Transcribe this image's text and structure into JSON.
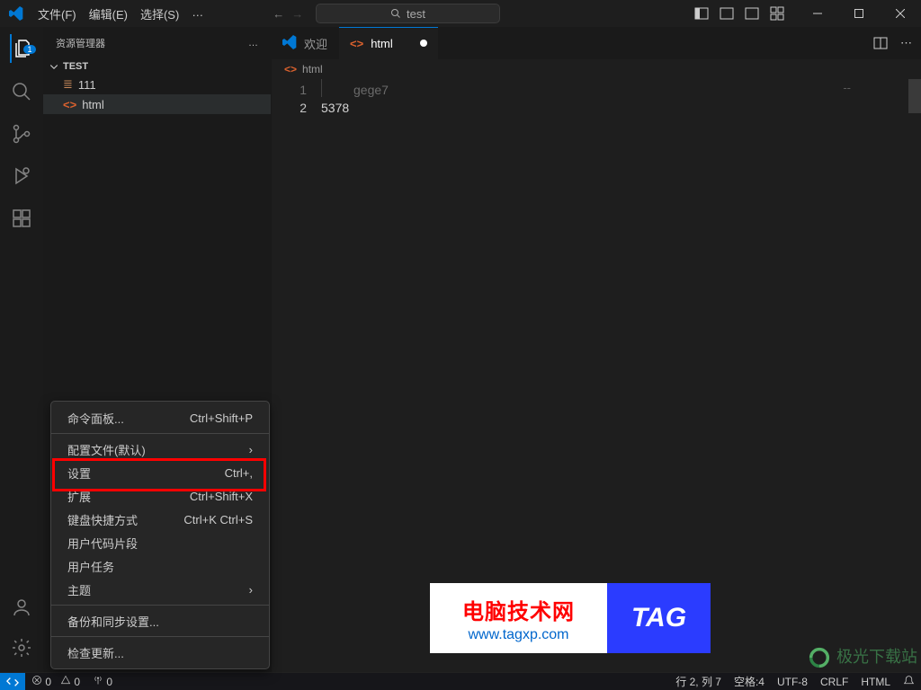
{
  "menu": {
    "file": "文件(F)",
    "edit": "编辑(E)",
    "select": "选择(S)",
    "more": "…"
  },
  "search": {
    "text": "test"
  },
  "sidebar": {
    "title": "资源管理器",
    "more": "…",
    "section": "TEST",
    "items": [
      {
        "label": "111"
      },
      {
        "label": "html"
      }
    ],
    "badge": "1"
  },
  "tabs": {
    "welcome": "欢迎",
    "html": "html"
  },
  "breadcrumb": {
    "file": "html"
  },
  "code": {
    "line1": "gege7",
    "line1num": "1",
    "line2": "5378",
    "line2num": "2",
    "mini": "--"
  },
  "ctx": {
    "cmdpalette": "命令面板...",
    "cmdpalette_sc": "Ctrl+Shift+P",
    "profile": "配置文件(默认)",
    "settings": "设置",
    "settings_sc": "Ctrl+,",
    "ext": "扩展",
    "ext_sc": "Ctrl+Shift+X",
    "kbd": "键盘快捷方式",
    "kbd_sc": "Ctrl+K Ctrl+S",
    "snippet": "用户代码片段",
    "tasks": "用户任务",
    "theme": "主题",
    "sync": "备份和同步设置...",
    "update": "检查更新..."
  },
  "status": {
    "err": "0",
    "warn": "0",
    "port": "0",
    "linecol": "行 2, 列 7",
    "spaces": "空格:4",
    "enc": "UTF-8",
    "eol": "CRLF",
    "lang": "HTML"
  },
  "wm": {
    "t1": "电脑技术网",
    "t2": "www.tagxp.com",
    "tag": "TAG",
    "dl": "极光下载站"
  }
}
